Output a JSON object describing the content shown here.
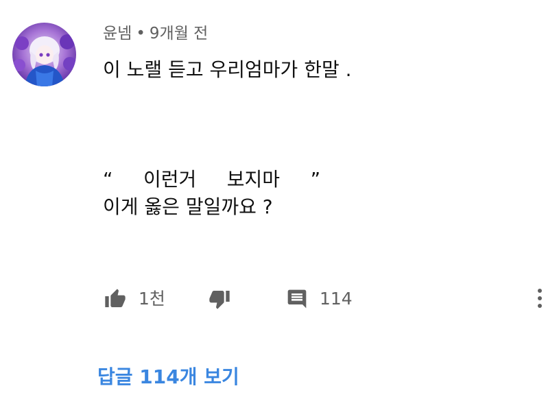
{
  "comment": {
    "author": "윤넴",
    "separator": "•",
    "timestamp": "9개월 전",
    "lines": [
      "이 노랠 듣고 우리엄마가 한말 .",
      "",
      "",
      "",
      "“     이런거     보지마     ”",
      "이게 옳은 말일까요 ?"
    ]
  },
  "actions": {
    "likes": "1천",
    "replies_count": "114"
  },
  "replies_link": "답글 114개 보기",
  "icons": {
    "like": "thumb-up-icon",
    "dislike": "thumb-down-icon",
    "reply": "comment-icon",
    "more": "more-vert-icon"
  },
  "colors": {
    "accent": "#3a86e0",
    "icon": "#606060",
    "text": "#0f0f0f",
    "muted": "#606060"
  }
}
